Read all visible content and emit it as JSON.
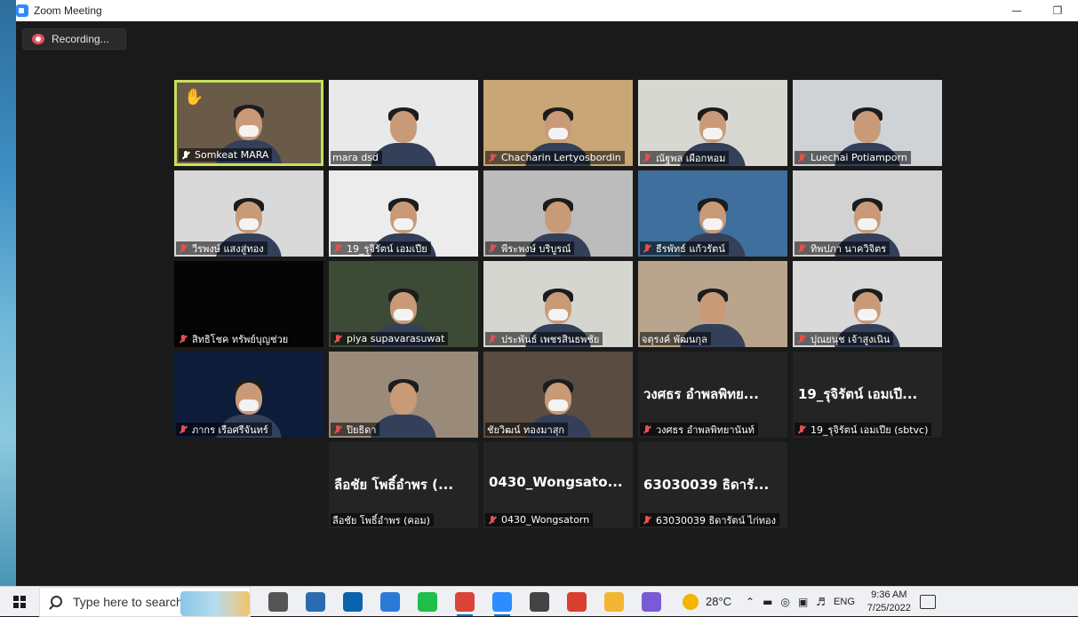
{
  "window": {
    "title": "Zoom Meeting"
  },
  "recording": {
    "label": "Recording..."
  },
  "participants": [
    {
      "name": "Somkeat MARA",
      "video": true,
      "muted": false,
      "active": true,
      "raised_hand": true,
      "big_name": "",
      "bg": "#6a5a48"
    },
    {
      "name": "mara dsd",
      "video": true,
      "muted": false,
      "active": false,
      "raised_hand": false,
      "big_name": "",
      "bg": "#e9e9e9"
    },
    {
      "name": "Chacharin Lertyosbordin",
      "video": true,
      "muted": true,
      "active": false,
      "raised_hand": false,
      "big_name": "",
      "bg": "#c8a675"
    },
    {
      "name": "ณัฐพล เผือกหอม",
      "video": true,
      "muted": true,
      "active": false,
      "raised_hand": false,
      "big_name": "",
      "bg": "#d8d8d2"
    },
    {
      "name": "Luechai Potiamporn",
      "video": true,
      "muted": true,
      "active": false,
      "raised_hand": false,
      "big_name": "",
      "bg": "#cfd3d6"
    },
    {
      "name": "วีรพงษ์ แสงสู่ทอง",
      "video": true,
      "muted": true,
      "active": false,
      "raised_hand": false,
      "big_name": "",
      "bg": "#d9d9d9"
    },
    {
      "name": "19_รุจิรัตน์ เอมเปีย",
      "video": true,
      "muted": true,
      "active": false,
      "raised_hand": false,
      "big_name": "",
      "bg": "#ececec"
    },
    {
      "name": "พีระพงษ์ บริบูรณ์",
      "video": true,
      "muted": true,
      "active": false,
      "raised_hand": false,
      "big_name": "",
      "bg": "#bcbcbc"
    },
    {
      "name": "ธีรพัทธ์ แก้วรัตน์",
      "video": true,
      "muted": true,
      "active": false,
      "raised_hand": false,
      "big_name": "",
      "bg": "#3f6f9c"
    },
    {
      "name": "ทิพปภา นาควิจิตร",
      "video": true,
      "muted": true,
      "active": false,
      "raised_hand": false,
      "big_name": "",
      "bg": "#d2d2d2"
    },
    {
      "name": "สิทธิโชค ทรัพย์บุญช่วย",
      "video": false,
      "muted": true,
      "active": false,
      "raised_hand": false,
      "big_name": "",
      "bg": "#050505"
    },
    {
      "name": "piya supavarasuwat",
      "video": true,
      "muted": true,
      "active": false,
      "raised_hand": false,
      "big_name": "",
      "bg": "#3d4a35"
    },
    {
      "name": "ประพันธ์ เพชรสินธพชัย",
      "video": true,
      "muted": true,
      "active": false,
      "raised_hand": false,
      "big_name": "",
      "bg": "#d6d6d0"
    },
    {
      "name": "จตุรงค์ พัฒนกุล",
      "video": true,
      "muted": false,
      "active": false,
      "raised_hand": false,
      "big_name": "",
      "bg": "#b9a58d"
    },
    {
      "name": "ปุณยนุช เจ้าสูงเนิน",
      "video": true,
      "muted": true,
      "active": false,
      "raised_hand": false,
      "big_name": "",
      "bg": "#d9d9d9"
    },
    {
      "name": "ภากร เรือศรีจันทร์",
      "video": true,
      "muted": true,
      "active": false,
      "raised_hand": false,
      "big_name": "",
      "bg": "#0d1c3b"
    },
    {
      "name": "ปิยธิดา",
      "video": true,
      "muted": true,
      "active": false,
      "raised_hand": false,
      "big_name": "",
      "bg": "#9a8a7a"
    },
    {
      "name": "ชัยวิฒน์ ทองมาสุก",
      "video": true,
      "muted": false,
      "active": false,
      "raised_hand": false,
      "big_name": "",
      "bg": "#5a4c40"
    },
    {
      "name": "วงศธร อำพลพิทยานันท์",
      "video": false,
      "muted": true,
      "active": false,
      "raised_hand": false,
      "big_name": "วงศธร อำพลพิทย...",
      "bg": "#242424"
    },
    {
      "name": "19_รุจิรัตน์ เอมเปีย (sbtvc)",
      "video": false,
      "muted": true,
      "active": false,
      "raised_hand": false,
      "big_name": "19_รุจิรัตน์ เอมเปี...",
      "bg": "#242424"
    },
    {
      "name": "ลือชัย โพธิ์อำพร (คอม)",
      "video": false,
      "muted": false,
      "active": false,
      "raised_hand": false,
      "big_name": "ลือชัย โพธิ์อำพร (...",
      "bg": "#242424"
    },
    {
      "name": "0430_Wongsatorn",
      "video": false,
      "muted": true,
      "active": false,
      "raised_hand": false,
      "big_name": "0430_Wongsato...",
      "bg": "#242424"
    },
    {
      "name": "63030039 ธิดารัตน์ ไก่ทอง",
      "video": false,
      "muted": true,
      "active": false,
      "raised_hand": false,
      "big_name": "63030039 ธิดารั...",
      "bg": "#242424"
    }
  ],
  "taskbar": {
    "search_placeholder": "Type here to search",
    "temperature": "28°C",
    "language": "ENG",
    "time": "9:36 AM",
    "date": "7/25/2022",
    "apps": [
      {
        "icon": "task-view-icon",
        "color": "#555555",
        "running": false
      },
      {
        "icon": "store-icon",
        "color": "#2b6cb0",
        "running": false
      },
      {
        "icon": "mail-icon",
        "color": "#0a64ad",
        "running": false
      },
      {
        "icon": "todo-icon",
        "color": "#2a7bd8",
        "running": false
      },
      {
        "icon": "line-icon",
        "color": "#1fbf4a",
        "running": false
      },
      {
        "icon": "chrome-icon",
        "color": "#db4437",
        "running": true
      },
      {
        "icon": "zoom-icon",
        "color": "#2d8cff",
        "running": true
      },
      {
        "icon": "settings-icon",
        "color": "#444444",
        "running": false
      },
      {
        "icon": "ccleaner-icon",
        "color": "#d93f2f",
        "running": false
      },
      {
        "icon": "file-explorer-icon",
        "color": "#f2b632",
        "running": false
      },
      {
        "icon": "paint-icon",
        "color": "#7a5bd6",
        "running": false
      }
    ]
  }
}
